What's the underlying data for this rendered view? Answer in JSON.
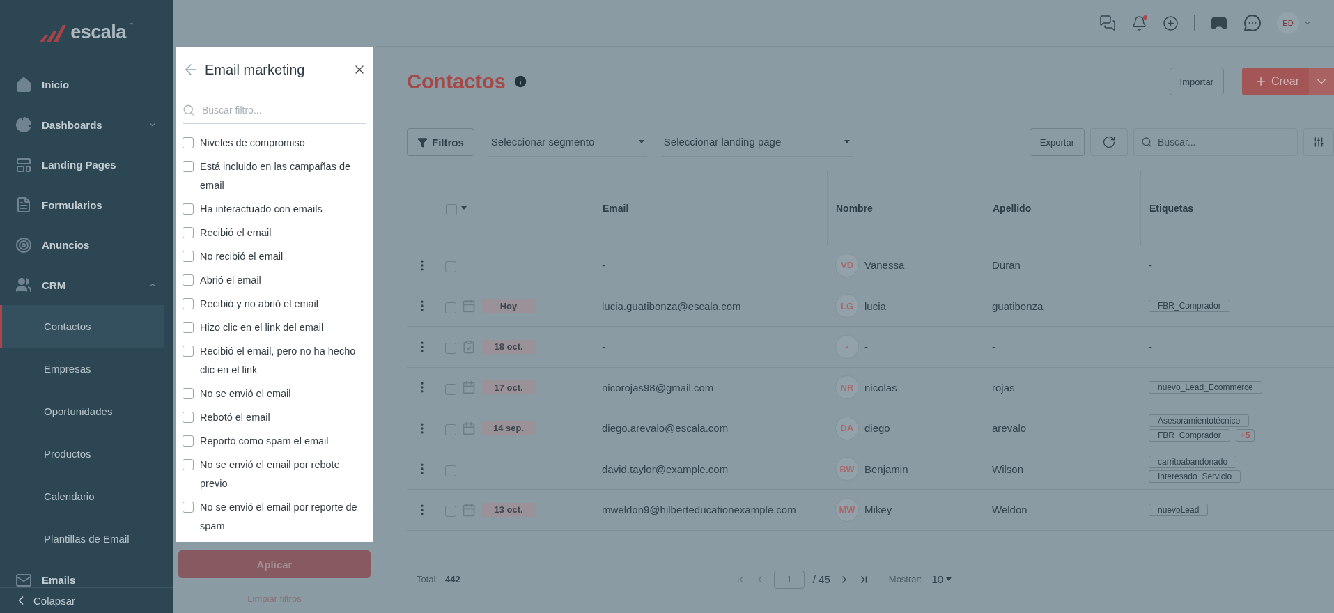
{
  "logo": {
    "name": "escala",
    "trademark": "™"
  },
  "sidebar": {
    "items": [
      {
        "label": "Inicio",
        "kind": "home"
      },
      {
        "label": "Dashboards",
        "kind": "chart",
        "expanded": false
      },
      {
        "label": "Landing Pages",
        "kind": "page"
      },
      {
        "label": "Formularios",
        "kind": "form"
      },
      {
        "label": "Anuncios",
        "kind": "target"
      },
      {
        "label": "CRM",
        "kind": "people",
        "expanded": true,
        "children": [
          {
            "label": "Contactos",
            "selected": true
          },
          {
            "label": "Empresas",
            "selected": false
          },
          {
            "label": "Oportunidades",
            "selected": false
          },
          {
            "label": "Productos",
            "selected": false
          },
          {
            "label": "Calendario",
            "selected": false
          },
          {
            "label": "Plantillas de Email",
            "selected": false
          }
        ]
      },
      {
        "label": "Emails",
        "kind": "mail"
      }
    ],
    "collapse": "Colapsar"
  },
  "topbar": {
    "unread_notifications": true,
    "avatar": "ED"
  },
  "filter_panel": {
    "title": "Email marketing",
    "search_placeholder": "Buscar filtro...",
    "options": [
      {
        "label": "Niveles de compromiso",
        "checked": false
      },
      {
        "label": "Está incluido en las campañas de email",
        "checked": false
      },
      {
        "label": "Ha interactuado con emails",
        "checked": false
      },
      {
        "label": "Recibió el email",
        "checked": false
      },
      {
        "label": "No recibió el email",
        "checked": false
      },
      {
        "label": "Abrió el email",
        "checked": false
      },
      {
        "label": "Recibió y no abrió el email",
        "checked": false
      },
      {
        "label": "Hizo clic en el link del email",
        "checked": false
      },
      {
        "label": "Recibió el email, pero no ha hecho clic en el link",
        "checked": false
      },
      {
        "label": "No se envió el email",
        "checked": false
      },
      {
        "label": "Rebotó el email",
        "checked": false
      },
      {
        "label": "Reportó como spam el email",
        "checked": false
      },
      {
        "label": "No se envió el email por rebote previo",
        "checked": false
      },
      {
        "label": "No se envió el email por reporte de spam",
        "checked": false
      }
    ],
    "apply": "Aplicar",
    "clear": "Limpiar filtros"
  },
  "page": {
    "title": "Contactos",
    "import": "Importar",
    "create": "Crear"
  },
  "toolbar": {
    "filters": "Filtros",
    "segment_placeholder": "Seleccionar segmento",
    "landing_placeholder": "Seleccionar landing page",
    "export": "Exportar",
    "search_placeholder": "Buscar..."
  },
  "table": {
    "select_all_checked": false,
    "columns": [
      "Email",
      "Nombre",
      "Apellido",
      "Etiquetas"
    ],
    "rows": [
      {
        "checked": false,
        "email": "-",
        "initials": "VD",
        "first_name": "Vanessa",
        "last_name": "Duran",
        "tags": [],
        "tags_text": "-"
      },
      {
        "checked": false,
        "kind": "calendar",
        "date": "Hoy",
        "email": "lucia.guatibonza@escala.com",
        "initials": "LG",
        "first_name": "lucia",
        "last_name": "guatibonza",
        "tags": [
          "FBR_Comprador"
        ]
      },
      {
        "checked": false,
        "kind": "task",
        "date": "18 oct.",
        "email": "-",
        "initials": "-",
        "first_name": "-",
        "last_name": "-",
        "tags": [],
        "tags_text": "-"
      },
      {
        "checked": false,
        "kind": "calendar",
        "date": "17 oct.",
        "email": "nicorojas98@gmail.com",
        "initials": "NR",
        "first_name": "nicolas",
        "last_name": "rojas",
        "tags": [
          "nuevo_Lead_Ecommerce"
        ]
      },
      {
        "checked": false,
        "kind": "calendar",
        "date": "14 sep.",
        "email": "diego.arevalo@escala.com",
        "initials": "DA",
        "first_name": "diego",
        "last_name": "arevalo",
        "tags": [
          "Asesoramientotécnico",
          "FBR_Comprador"
        ],
        "more": "+5"
      },
      {
        "checked": false,
        "email": "david.taylor@example.com",
        "initials": "BW",
        "first_name": "Benjamin",
        "last_name": "Wilson",
        "tags": [
          "carritoabandonado",
          "Interesado_Servicio"
        ]
      },
      {
        "checked": false,
        "kind": "calendar",
        "date": "13 oct.",
        "email": "mweldon9@hilberteducationexample.com",
        "initials": "MW",
        "first_name": "Mikey",
        "last_name": "Weldon",
        "tags": [
          "nuevoLead"
        ]
      }
    ]
  },
  "footer": {
    "total_label": "Total:",
    "total": "442",
    "page": "1",
    "pages": "/ 45",
    "show_label": "Mostrar:",
    "show": "10"
  }
}
